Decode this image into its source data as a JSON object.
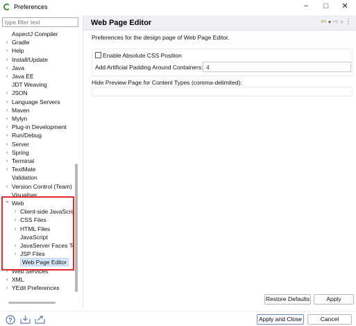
{
  "window": {
    "title": "Preferences",
    "minimize": "−",
    "maximize": "□",
    "close": "✕"
  },
  "filter": {
    "placeholder": "type filter text",
    "value": ""
  },
  "tree": [
    {
      "label": "AspectJ Compiler",
      "indent": 0,
      "expandable": false,
      "expanded": false,
      "partial": true
    },
    {
      "label": "Gradle",
      "indent": 0,
      "expandable": true,
      "expanded": false
    },
    {
      "label": "Help",
      "indent": 0,
      "expandable": true,
      "expanded": false
    },
    {
      "label": "Install/Update",
      "indent": 0,
      "expandable": true,
      "expanded": false
    },
    {
      "label": "Java",
      "indent": 0,
      "expandable": true,
      "expanded": false
    },
    {
      "label": "Java EE",
      "indent": 0,
      "expandable": true,
      "expanded": false
    },
    {
      "label": "JDT Weaving",
      "indent": 0,
      "expandable": false,
      "expanded": false
    },
    {
      "label": "JSON",
      "indent": 0,
      "expandable": true,
      "expanded": false
    },
    {
      "label": "Language Servers",
      "indent": 0,
      "expandable": true,
      "expanded": false
    },
    {
      "label": "Maven",
      "indent": 0,
      "expandable": true,
      "expanded": false
    },
    {
      "label": "Mylyn",
      "indent": 0,
      "expandable": true,
      "expanded": false
    },
    {
      "label": "Plug-in Development",
      "indent": 0,
      "expandable": true,
      "expanded": false
    },
    {
      "label": "Run/Debug",
      "indent": 0,
      "expandable": true,
      "expanded": false
    },
    {
      "label": "Server",
      "indent": 0,
      "expandable": true,
      "expanded": false
    },
    {
      "label": "Spring",
      "indent": 0,
      "expandable": true,
      "expanded": false
    },
    {
      "label": "Terminal",
      "indent": 0,
      "expandable": true,
      "expanded": false
    },
    {
      "label": "TextMate",
      "indent": 0,
      "expandable": true,
      "expanded": false
    },
    {
      "label": "Validation",
      "indent": 0,
      "expandable": false,
      "expanded": false
    },
    {
      "label": "Version Control (Team)",
      "indent": 0,
      "expandable": true,
      "expanded": false
    },
    {
      "label": "Visualiser",
      "indent": 0,
      "expandable": false,
      "expanded": false
    },
    {
      "label": "Web",
      "indent": 0,
      "expandable": true,
      "expanded": true
    },
    {
      "label": "Client-side JavaScript",
      "indent": 1,
      "expandable": true,
      "expanded": false
    },
    {
      "label": "CSS Files",
      "indent": 1,
      "expandable": true,
      "expanded": false
    },
    {
      "label": "HTML Files",
      "indent": 1,
      "expandable": true,
      "expanded": false
    },
    {
      "label": "JavaScript",
      "indent": 1,
      "expandable": false,
      "expanded": false
    },
    {
      "label": "JavaServer Faces Tools",
      "indent": 1,
      "expandable": true,
      "expanded": false
    },
    {
      "label": "JSP Files",
      "indent": 1,
      "expandable": true,
      "expanded": false
    },
    {
      "label": "Web Page Editor",
      "indent": 1,
      "expandable": false,
      "expanded": false,
      "selected": true
    },
    {
      "label": "Web Services",
      "indent": 0,
      "expandable": true,
      "expanded": false,
      "partial": true
    },
    {
      "label": "XML",
      "indent": 0,
      "expandable": true,
      "expanded": false
    },
    {
      "label": "YEdit Preferences",
      "indent": 0,
      "expandable": true,
      "expanded": false
    }
  ],
  "page": {
    "title": "Web Page Editor",
    "description": "Preferences for the design page of Web Page Editor.",
    "absolute_css_label": "Enable Absolute CSS Position",
    "absolute_css_checked": false,
    "padding_label": "Add Artificial Padding Around Containers:",
    "padding_value": "4",
    "hide_preview_label": "Hide Preview Page for Content Types (comma-delimited):",
    "hide_preview_value": ""
  },
  "nav": {
    "back": "⇦",
    "back_menu": "▾",
    "forward": "⇨",
    "forward_menu": "▾",
    "view_menu": "⋮"
  },
  "buttons": {
    "restore_defaults": "Restore Defaults",
    "apply": "Apply",
    "apply_and_close": "Apply and Close",
    "cancel": "Cancel"
  },
  "bottom_icons": [
    "help-icon",
    "import-icon",
    "export-icon"
  ],
  "colors": {
    "highlight_box": "#e02828",
    "selection": "#d9e9fb",
    "header_bg": "#eef0f4",
    "primary_border": "#6b8fc9"
  }
}
